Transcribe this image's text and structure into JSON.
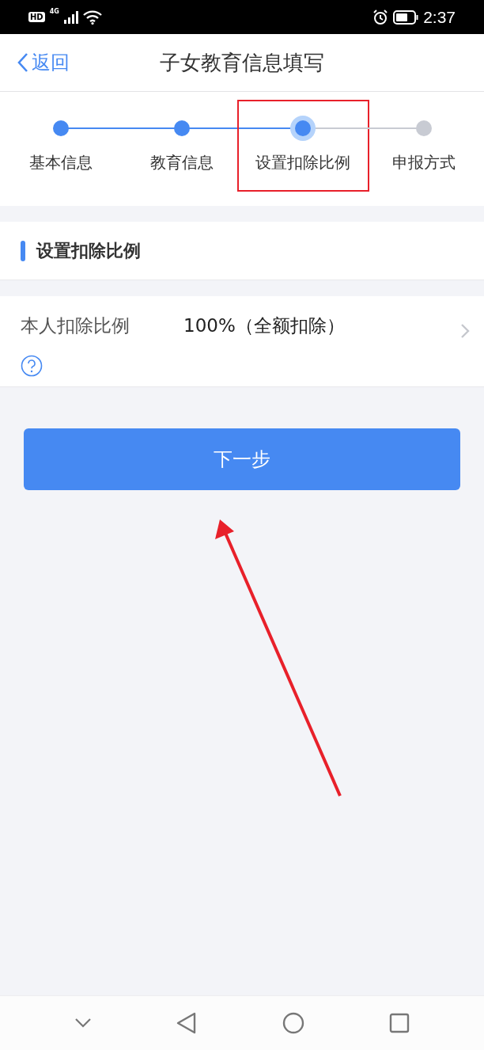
{
  "status_bar": {
    "hd": "HD",
    "network": "4G",
    "time": "2:37"
  },
  "header": {
    "back": "返回",
    "title": "子女教育信息填写"
  },
  "steps": [
    {
      "label": "基本信息",
      "completed": true,
      "selected": false,
      "highlighted": false
    },
    {
      "label": "教育信息",
      "completed": true,
      "selected": false,
      "highlighted": false
    },
    {
      "label": "设置扣除比例",
      "completed": false,
      "selected": true,
      "highlighted": true
    },
    {
      "label": "申报方式",
      "completed": false,
      "selected": false,
      "highlighted": false
    }
  ],
  "section": {
    "title": "设置扣除比例"
  },
  "field": {
    "label": "本人扣除比例",
    "value": "100%（全额扣除）"
  },
  "next_button": "下一步",
  "pointer_arrow": true
}
